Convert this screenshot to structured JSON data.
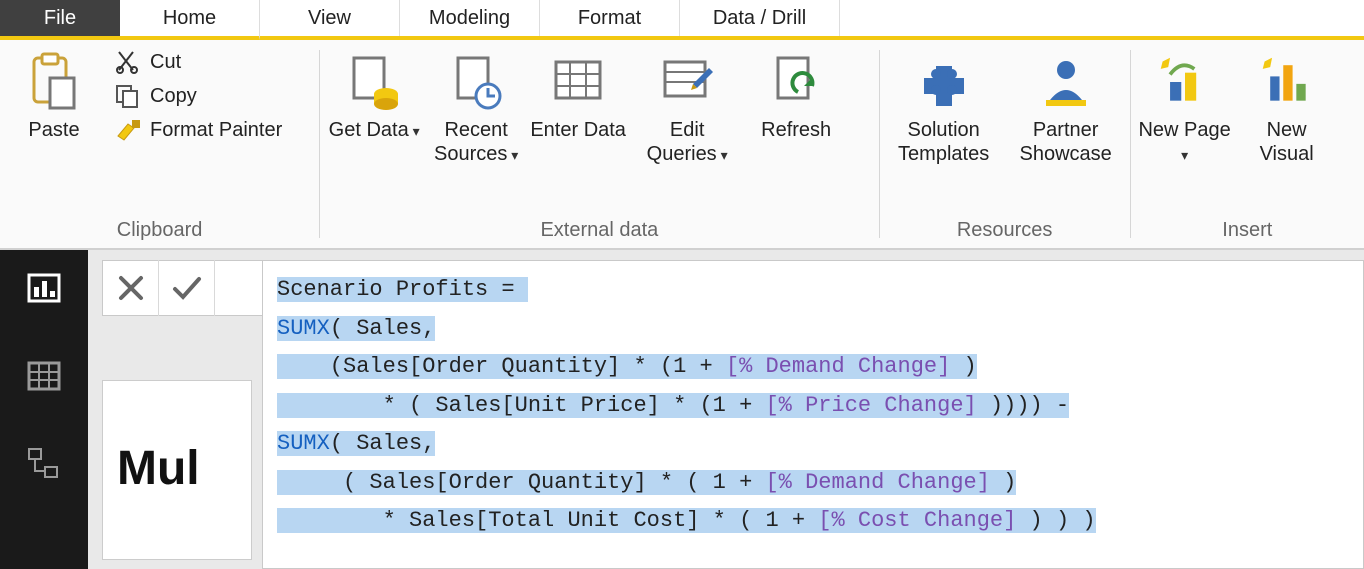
{
  "tabs": {
    "file": "File",
    "items": [
      "Home",
      "View",
      "Modeling",
      "Format",
      "Data / Drill"
    ],
    "active_index": 0
  },
  "ribbon": {
    "clipboard": {
      "group_label": "Clipboard",
      "paste": "Paste",
      "cut": "Cut",
      "copy": "Copy",
      "format_painter": "Format Painter"
    },
    "external": {
      "group_label": "External data",
      "get_data": "Get\nData",
      "recent_sources": "Recent\nSources",
      "enter_data": "Enter\nData",
      "edit_queries": "Edit\nQueries",
      "refresh": "Refresh"
    },
    "resources": {
      "group_label": "Resources",
      "solution_templates": "Solution\nTemplates",
      "partner_showcase": "Partner\nShowcase"
    },
    "insert": {
      "group_label": "Insert",
      "new_page": "New\nPage",
      "new_visual": "New\nVisual"
    }
  },
  "leftnav": {
    "report": "report-view",
    "data": "data-view",
    "model": "model-view"
  },
  "formula": {
    "tokens": [
      {
        "t": "Scenario Profits = ",
        "c": "tx",
        "br": true
      },
      {
        "t": "SUMX",
        "c": "kw"
      },
      {
        "t": "( Sales,",
        "c": "tx",
        "br": true
      },
      {
        "t": "    (Sales[Order Quantity] * (1 + ",
        "c": "tx"
      },
      {
        "t": "[% Demand Change]",
        "c": "ms"
      },
      {
        "t": " )",
        "c": "tx",
        "br": true
      },
      {
        "t": "        * ( Sales[Unit Price] * (1 + ",
        "c": "tx"
      },
      {
        "t": "[% Price Change]",
        "c": "ms"
      },
      {
        "t": " )))) -",
        "c": "tx",
        "br": true
      },
      {
        "t": "SUMX",
        "c": "kw"
      },
      {
        "t": "( Sales,",
        "c": "tx",
        "br": true
      },
      {
        "t": "     ( Sales[Order Quantity] * ( 1 + ",
        "c": "tx"
      },
      {
        "t": "[% Demand Change]",
        "c": "ms"
      },
      {
        "t": " )",
        "c": "tx",
        "br": true
      },
      {
        "t": "        * Sales[Total Unit Cost] * ( 1 + ",
        "c": "tx"
      },
      {
        "t": "[% Cost Change]",
        "c": "ms"
      },
      {
        "t": " ) ) )",
        "c": "tx"
      }
    ]
  },
  "report_peek": "Mul"
}
